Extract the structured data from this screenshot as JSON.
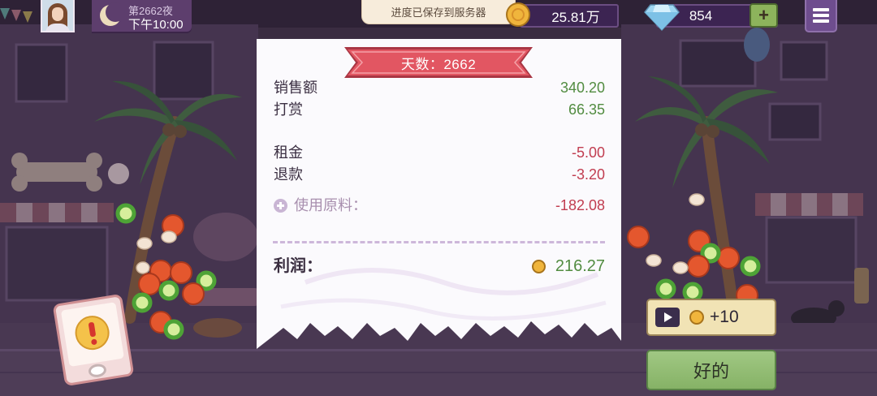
{
  "hud": {
    "night_label": "第2662夜",
    "time_label": "下午10:00",
    "save_toast": "进度已保存到服务器",
    "coin_balance": "25.81万",
    "gem_balance": "854",
    "add_gems_label": "+"
  },
  "receipt": {
    "day_banner": "天数：2662",
    "income": [
      {
        "label": "销售额",
        "value": "340.20"
      },
      {
        "label": "打赏",
        "value": "66.35"
      }
    ],
    "expenses": [
      {
        "label": "租金",
        "value": "-5.00"
      },
      {
        "label": "退款",
        "value": "-3.20"
      }
    ],
    "ingredients": {
      "label": "使用原料：",
      "value": "-182.08"
    },
    "profit": {
      "label": "利润：",
      "value": "216.27"
    }
  },
  "actions": {
    "ad_reward_label": "+10",
    "ok_label": "好的"
  },
  "icons": {
    "avatar": "player-portrait",
    "moon": "crescent-moon-icon",
    "coin": "coin-icon",
    "gem": "diamond-icon",
    "menu": "hamburger-menu-icon",
    "expand_ingredients": "plus-circle-icon",
    "watch_ad": "play-video-icon",
    "alert": "exclamation-icon"
  },
  "colors": {
    "positive_value": "#528c41",
    "negative_value": "#c13d50",
    "banner": "#e25662",
    "ok_button": "#92bd72",
    "ad_button": "#f1e3b5",
    "hud_panel": "#3c2452",
    "scene_background": "#3a2c41"
  }
}
